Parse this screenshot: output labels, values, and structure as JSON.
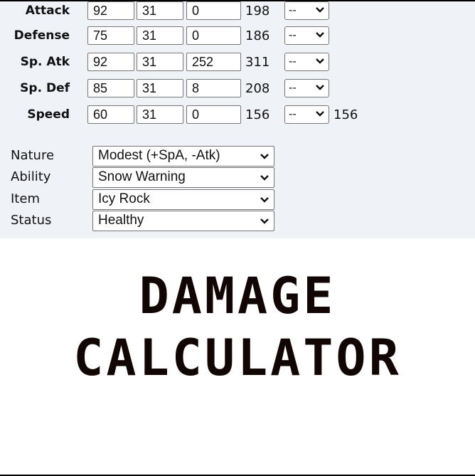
{
  "stats": [
    {
      "label": "Attack",
      "base": "92",
      "iv": "31",
      "ev": "0",
      "total": "198",
      "nature_mod": "--"
    },
    {
      "label": "Defense",
      "base": "75",
      "iv": "31",
      "ev": "0",
      "total": "186",
      "nature_mod": "--"
    },
    {
      "label": "Sp. Atk",
      "base": "92",
      "iv": "31",
      "ev": "252",
      "total": "311",
      "nature_mod": "--"
    },
    {
      "label": "Sp. Def",
      "base": "85",
      "iv": "31",
      "ev": "8",
      "total": "208",
      "nature_mod": "--"
    },
    {
      "label": "Speed",
      "base": "60",
      "iv": "31",
      "ev": "0",
      "total": "156",
      "nature_mod": "--",
      "final": "156"
    }
  ],
  "fields": {
    "nature": {
      "label": "Nature",
      "value": "Modest (+SpA, -Atk)"
    },
    "ability": {
      "label": "Ability",
      "value": "Snow Warning"
    },
    "item": {
      "label": "Item",
      "value": "Icy Rock"
    },
    "status": {
      "label": "Status",
      "value": "Healthy"
    }
  },
  "banner": {
    "line1": "DAMAGE",
    "line2": "CALCULATOR"
  },
  "colors": {
    "panel_bg": "#eff3f8",
    "banner_text": "#120604"
  }
}
